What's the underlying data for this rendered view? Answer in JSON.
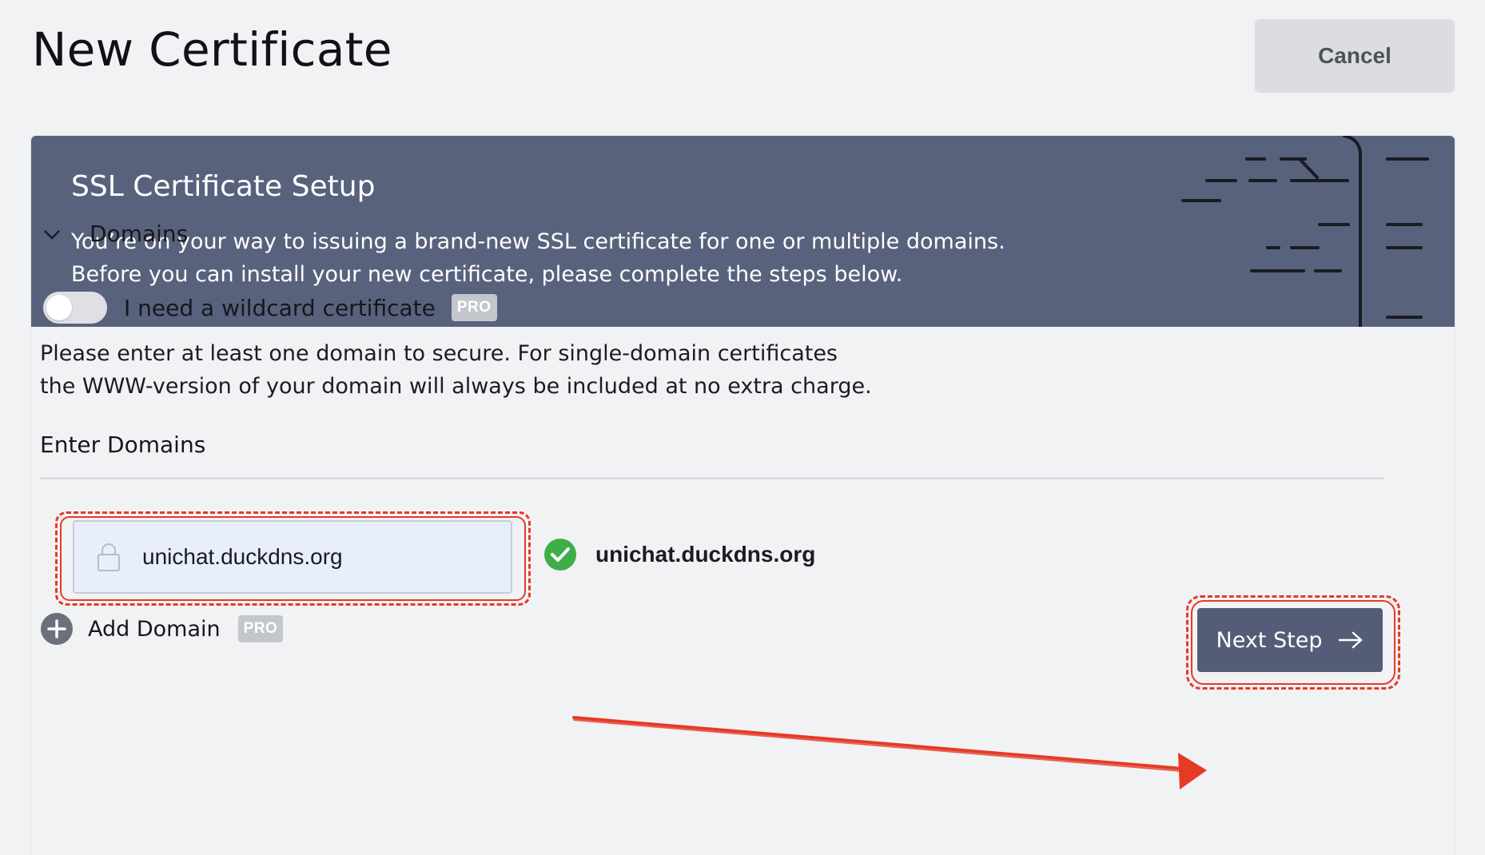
{
  "header": {
    "title": "New Certificate",
    "cancel_label": "Cancel"
  },
  "banner": {
    "title": "SSL Certificate Setup",
    "description_line1": "You’re on your way to issuing a brand-new SSL certificate for one or multiple domains.",
    "description_line2": "Before you can install your new certificate, please complete the steps below."
  },
  "domains_section": {
    "title": "Domains",
    "expanded": true,
    "wildcard": {
      "label": "I need a wildcard certificate",
      "enabled": false,
      "badge": "PRO"
    },
    "help_line1": "Please enter at least one domain to secure. For single-domain certificates",
    "help_line2": "the WWW-version of your domain will always be included at no extra charge.",
    "enter_domains_label": "Enter Domains",
    "domain_input_value": "unichat.duckdns.org",
    "validated_domain": "unichat.duckdns.org",
    "add_domain_label": "Add Domain",
    "add_domain_badge": "PRO"
  },
  "actions": {
    "next_step_label": "Next Step"
  },
  "colors": {
    "banner": "#59627c",
    "primary_button": "#545c77",
    "valid_check": "#3fae49",
    "annotation": "#e63a26",
    "pro_badge": "#c3c6cd"
  }
}
